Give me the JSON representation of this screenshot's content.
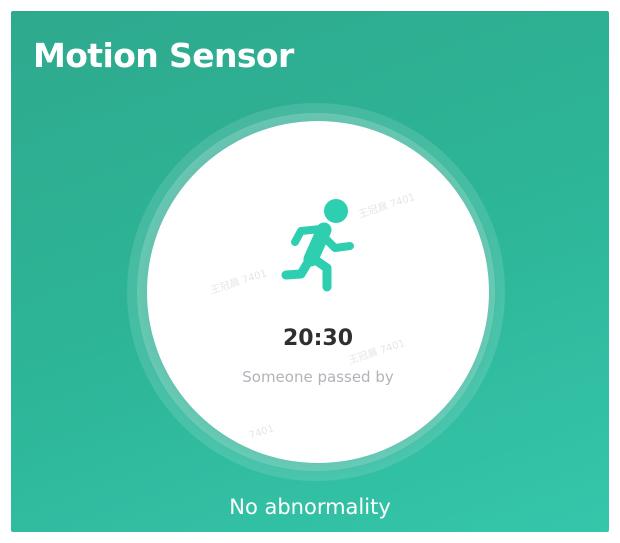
{
  "header": {
    "title": "Motion Sensor"
  },
  "sensor": {
    "icon": "running-person-icon",
    "time": "20:30",
    "event": "Someone passed by"
  },
  "status": {
    "text": "No abnormality"
  },
  "watermarks": [
    "王冠晨 7401",
    "王冠晨 7401",
    "王冠晨 7401",
    "7401"
  ],
  "colors": {
    "accent": "#2db597",
    "icon": "#2ecfb1",
    "time_text": "#2f2f2f",
    "event_text": "#b0b4b8"
  }
}
